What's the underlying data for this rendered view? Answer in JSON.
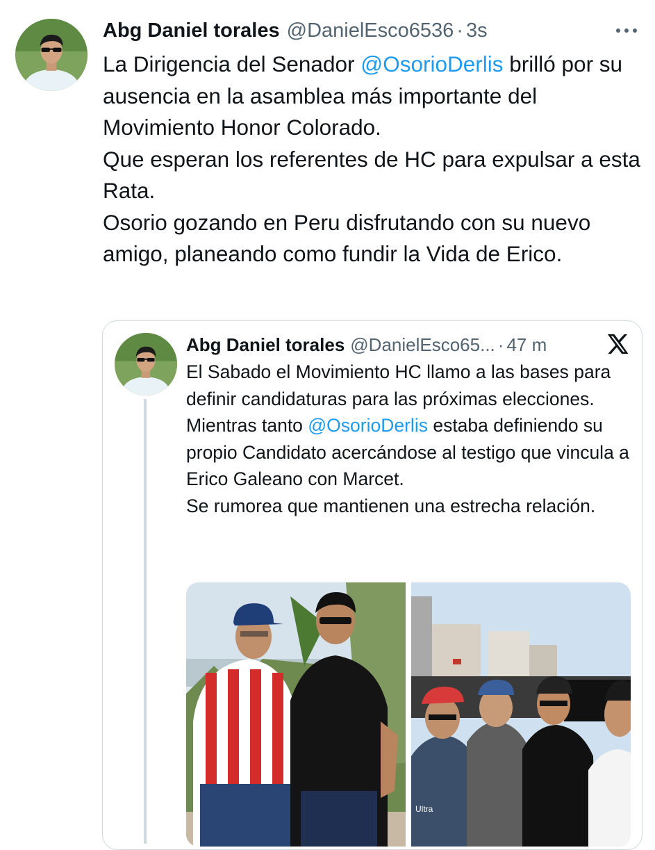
{
  "tweet": {
    "author_name": "Abg Daniel torales",
    "handle": "@DanielEsco6536",
    "separator": "·",
    "time": "3s",
    "more_icon": "more-horizontal-icon",
    "text_lines": [
      {
        "before": "La Dirigencia del Senador ",
        "mention": "@OsorioDerlis",
        "after": " brilló por su ausencia en la asamblea más importante del Movimiento Honor Colorado."
      },
      {
        "text": "Que esperan los referentes de HC para expulsar a esta Rata."
      },
      {
        "text": "Osorio gozando en Peru disfrutando con su nuevo amigo, planeando como fundir la Vida de Erico."
      }
    ]
  },
  "quoted_tweet": {
    "author_name": "Abg Daniel torales",
    "handle": "@DanielEsco65...",
    "separator": "·",
    "time": "47 m",
    "platform_icon": "x-logo-icon",
    "text_lines": [
      {
        "text": "El Sabado el Movimiento HC llamo a las bases para definir candidaturas para las próximas elecciones."
      },
      {
        "before": "Mientras tanto ",
        "mention": "@OsorioDerlis",
        "after": " estaba definiendo su propio Candidato acercándose al testigo que vincula a Erico Galeano con Marcet."
      },
      {
        "text": "Se rumorea que mantienen una estrecha relación."
      }
    ],
    "photo_text": "Ultra"
  },
  "colors": {
    "text": "#0f1419",
    "secondary": "#536471",
    "mention": "#1d9bf0",
    "border": "#cfd9de"
  }
}
